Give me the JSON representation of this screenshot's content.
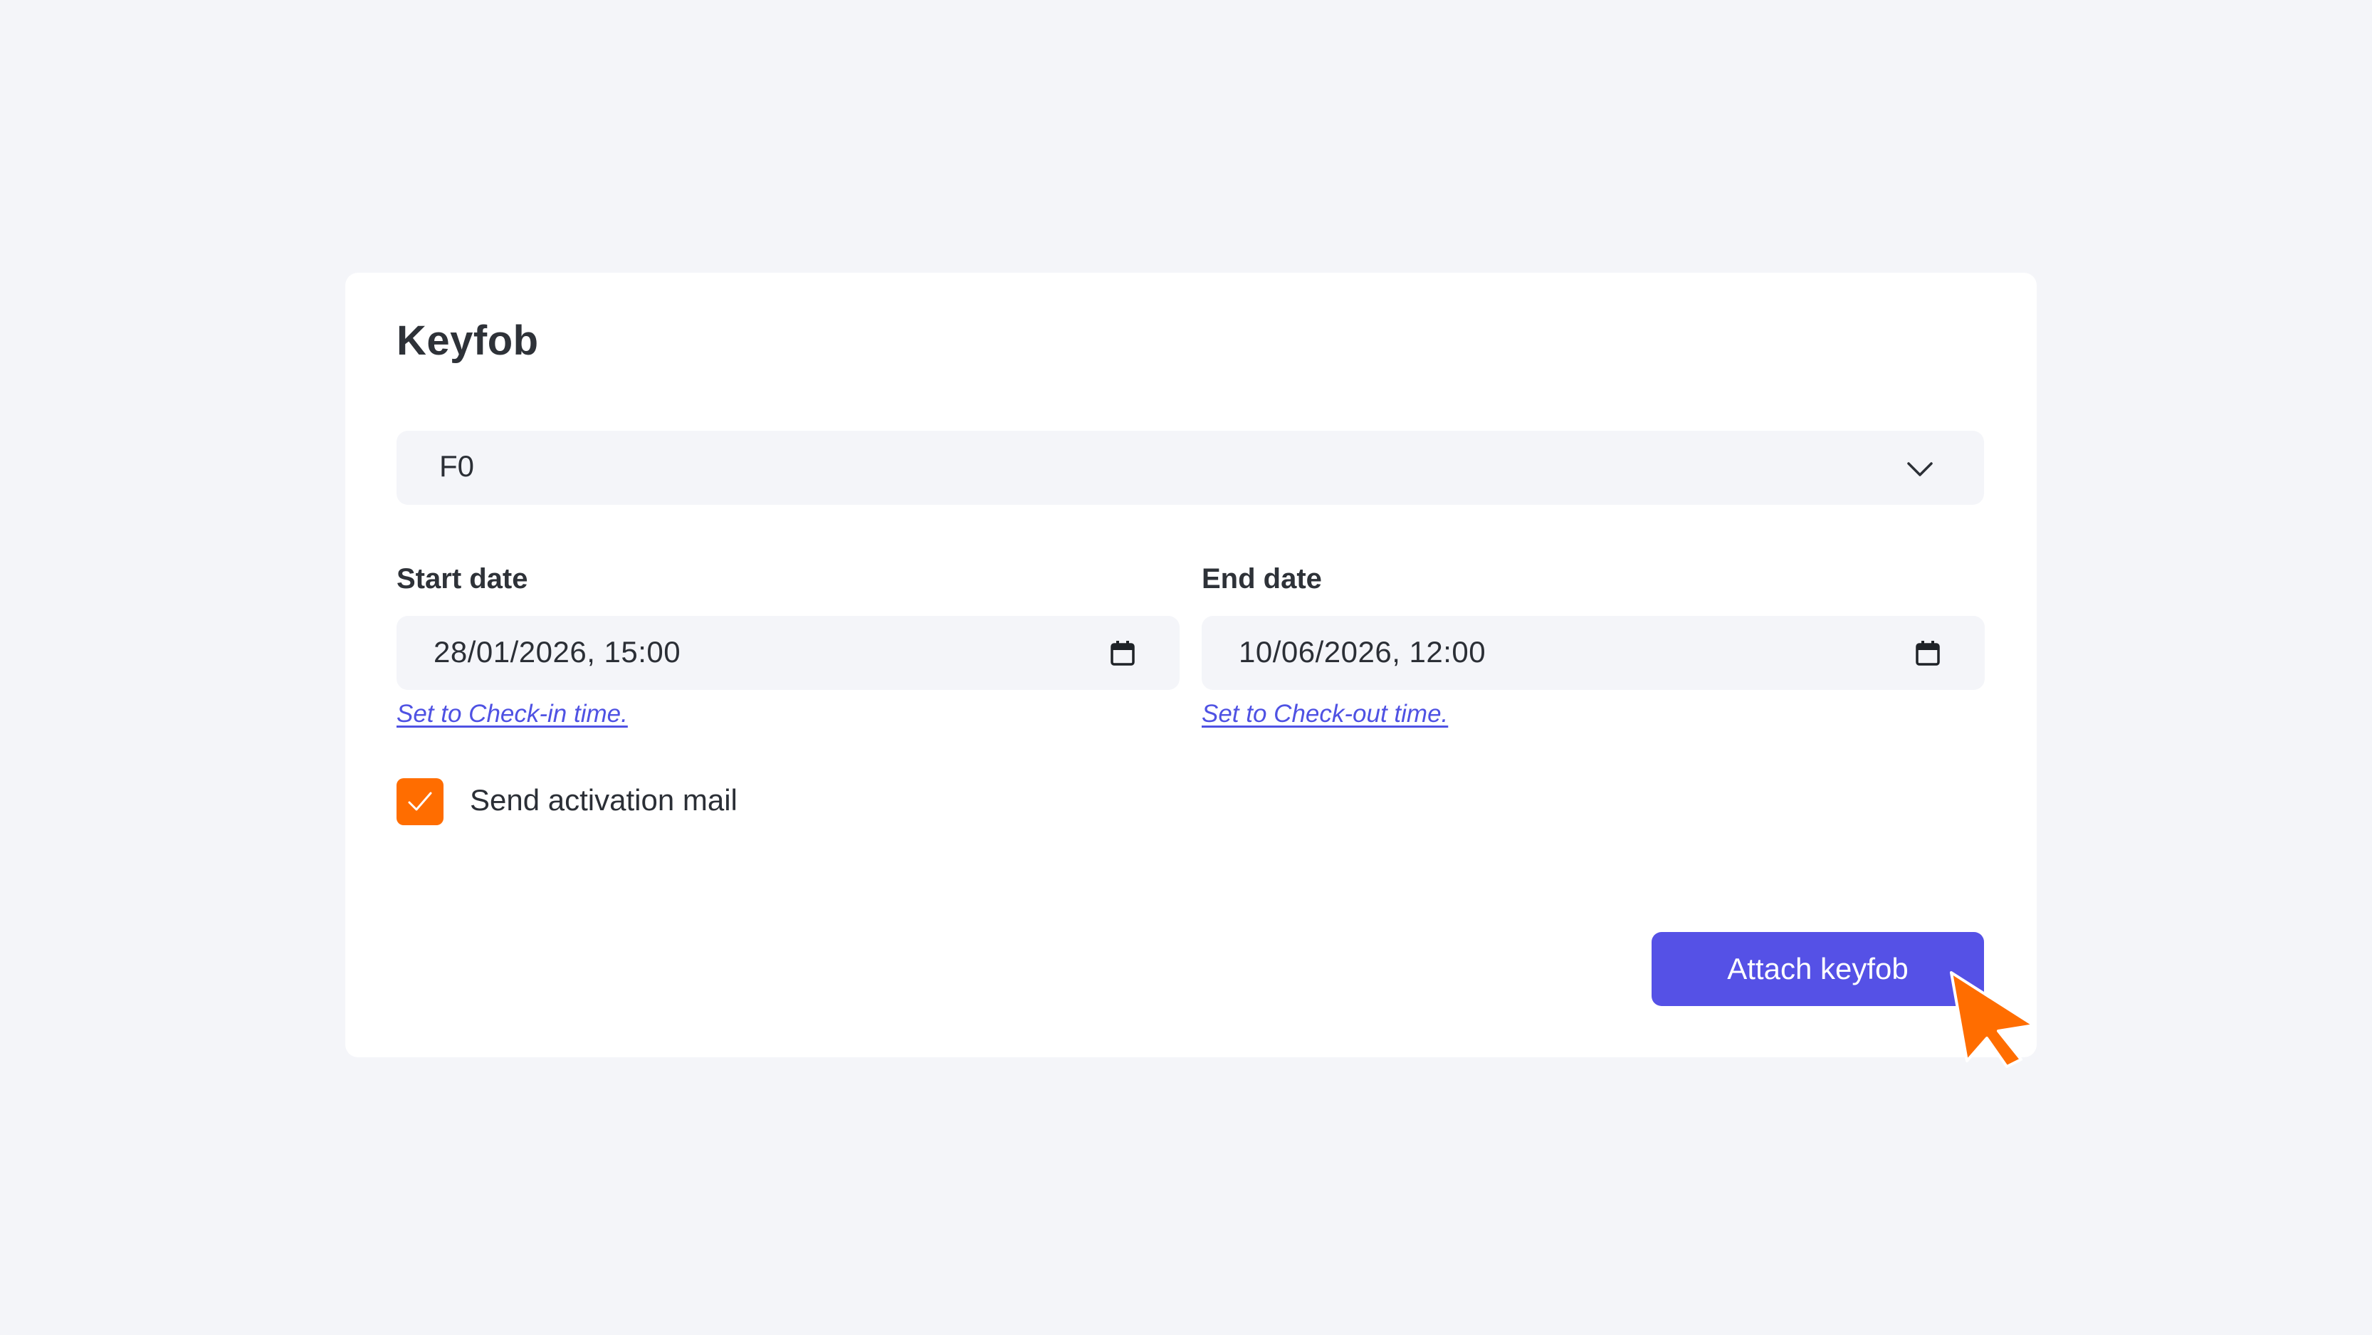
{
  "card": {
    "title": "Keyfob"
  },
  "keyfob_select": {
    "selected_value": "F0",
    "icon": "chevron-down-icon"
  },
  "start_date": {
    "label": "Start date",
    "value": "28/01/2026, 15:00",
    "icon": "calendar-icon",
    "helper_link": "Set to Check-in time."
  },
  "end_date": {
    "label": "End date",
    "value": "10/06/2026, 12:00",
    "icon": "calendar-icon",
    "helper_link": "Set to Check-out time."
  },
  "activation_mail": {
    "label": "Send activation mail",
    "checked": true
  },
  "actions": {
    "attach_label": "Attach keyfob"
  },
  "colors": {
    "page_background": "#f4f5f9",
    "card_background": "#ffffff",
    "field_background": "#f4f5f9",
    "primary": "#5551e6",
    "link": "#4f52e3",
    "checkbox": "#ff6d00",
    "cursor": "#ff6d00"
  }
}
